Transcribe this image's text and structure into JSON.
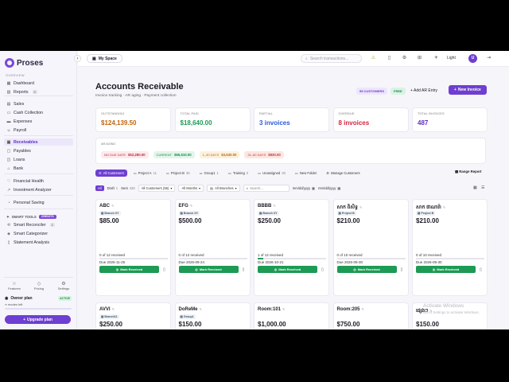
{
  "brand": {
    "name": "Proses"
  },
  "sidebar": {
    "overview_label": "OVERVIEW",
    "items": [
      {
        "label": "Dashboard",
        "icon": "grid-icon"
      },
      {
        "label": "Reports",
        "icon": "chart-icon",
        "count": "2"
      },
      {
        "label": "Sales",
        "icon": "receipt-icon"
      },
      {
        "label": "Cash Collection",
        "icon": "wallet-icon"
      },
      {
        "label": "Expenses",
        "icon": "card-icon"
      },
      {
        "label": "Payroll",
        "icon": "people-icon"
      },
      {
        "label": "Receivables",
        "icon": "inbox-icon"
      },
      {
        "label": "Payables",
        "icon": "outbox-icon"
      },
      {
        "label": "Loans",
        "icon": "loan-icon"
      },
      {
        "label": "Bank",
        "icon": "bank-icon"
      },
      {
        "label": "Financial Health",
        "icon": "heart-icon"
      },
      {
        "label": "Investment Analyzer",
        "icon": "trend-icon"
      },
      {
        "label": "Personal Saving",
        "icon": "piggy-icon"
      }
    ],
    "smart_tools_label": "SMART TOOLS",
    "credits_label": "CREDITS",
    "smart_items": [
      {
        "label": "Smart Reconciler",
        "icon": "sync-icon",
        "count": "1"
      },
      {
        "label": "Smart Categorizer",
        "icon": "tag-icon"
      },
      {
        "label": "Statement Analysis",
        "icon": "doc-icon"
      }
    ],
    "bottom": [
      {
        "label": "Features",
        "icon": "star-icon"
      },
      {
        "label": "Pricing",
        "icon": "price-icon"
      },
      {
        "label": "Settings",
        "icon": "gear-icon"
      }
    ],
    "plan": {
      "name": "Owner plan",
      "status": "ACTIVE",
      "usage": "∞ modes left",
      "usage_fraction": 0
    },
    "upgrade_label": "Upgrade plan"
  },
  "topbar": {
    "space_label": "My Space",
    "search_placeholder": "Search transactions...",
    "theme_label": "Light",
    "avatar_initial": "U"
  },
  "page": {
    "title": "Accounts Receivable",
    "subtitle": "Invoice tracking · AR aging · Payment collection",
    "customers_badge": "55 CUSTOMERS",
    "free_badge": "FREE",
    "add_ar_label": "Add AR Entry",
    "new_invoice_label": "New Invoice"
  },
  "stats": [
    {
      "label": "OUTSTANDING",
      "value": "$124,139.50",
      "color": "#c0650c"
    },
    {
      "label": "TOTAL PAID",
      "value": "$18,640.00",
      "color": "#1d9a54"
    },
    {
      "label": "PARTIAL",
      "value": "3 invoices",
      "color": "#2a5bd7"
    },
    {
      "label": "OVERDUE",
      "value": "8 invoices",
      "color": "#d6243b"
    },
    {
      "label": "TOTAL INVOICES",
      "value": "487",
      "color": "#5b2fc2"
    }
  ],
  "aging": {
    "label": "AR AGING",
    "buckets": [
      {
        "label": "NO DUE DATE",
        "value": "$52,280.00",
        "bg": "#fdeaec",
        "color": "#c2273b"
      },
      {
        "label": "CURRENT",
        "value": "$65,510.00",
        "bg": "#e3f5ea",
        "color": "#1d8a4e"
      },
      {
        "label": "1–30 DAYS",
        "value": "$3,530.00",
        "bg": "#fdf1dd",
        "color": "#b56b0a"
      },
      {
        "label": "31–60 DAYS",
        "value": "$830.00",
        "bg": "#fde6e3",
        "color": "#c23a26"
      }
    ]
  },
  "tabs": [
    {
      "label": "All Customers",
      "count": "",
      "active": true
    },
    {
      "label": "Project A",
      "count": "11"
    },
    {
      "label": "Project B",
      "count": "38"
    },
    {
      "label": "Group1",
      "count": "1"
    },
    {
      "label": "Training",
      "count": "0"
    },
    {
      "label": "Unassigned",
      "count": "30"
    },
    {
      "label": "New Folder",
      "count": ""
    },
    {
      "label": "Manage Customers",
      "count": ""
    }
  ],
  "range_report": "Range Report",
  "filters": {
    "all": "All",
    "draft": "Draft",
    "draft_n": "1",
    "sent": "Sent",
    "sent_n": "436",
    "customers": "All Customers (55)",
    "months": "All Months",
    "branches": "All Branches",
    "search_placeholder": "Search...",
    "date1": "mm/dd/yyyy",
    "date2": "mm/dd/yyyy"
  },
  "mark_label": "Mark Received",
  "cards": [
    {
      "name": "ABC",
      "tag": "Branch XY",
      "amount": "$85.00",
      "received": "0 of 12 received",
      "progress": 0,
      "due": "Due 2026-11-25"
    },
    {
      "name": "EFG",
      "tag": "Branch XY",
      "amount": "$500.00",
      "received": "0 of 12 received",
      "progress": 0,
      "due": "Due 2026-09-24"
    },
    {
      "name": "BBBB",
      "tag": "Branch XY",
      "amount": "$250.00",
      "received": "1 of 12 received",
      "progress": 0.0833,
      "due": "Due 2026-10-21"
    },
    {
      "name": "សាក ពិសិទ្ធ",
      "tag": "Project B",
      "amount": "$210.00",
      "received": "0 of 10 received",
      "progress": 0,
      "due": "Due 2026-09-30"
    },
    {
      "name": "សាក ផាណារ៉ា",
      "tag": "Project B",
      "amount": "$210.00",
      "received": "0 of 10 received",
      "progress": 0,
      "due": "Due 2026-09-30"
    },
    {
      "name": "AVVI",
      "tag": "Branch11",
      "amount": "$250.00"
    },
    {
      "name": "DoReMe",
      "tag": "Group1",
      "amount": "$150.00"
    },
    {
      "name": "Room:101",
      "tag": "",
      "amount": "$1,000.00"
    },
    {
      "name": "Room:205",
      "tag": "",
      "amount": "$750.00"
    },
    {
      "name": "ផ្សេងៗ",
      "tag": "",
      "amount": "$150.00"
    }
  ],
  "watermark": {
    "line1": "Activate Windows",
    "line2": "Go to Settings to activate Windows."
  }
}
